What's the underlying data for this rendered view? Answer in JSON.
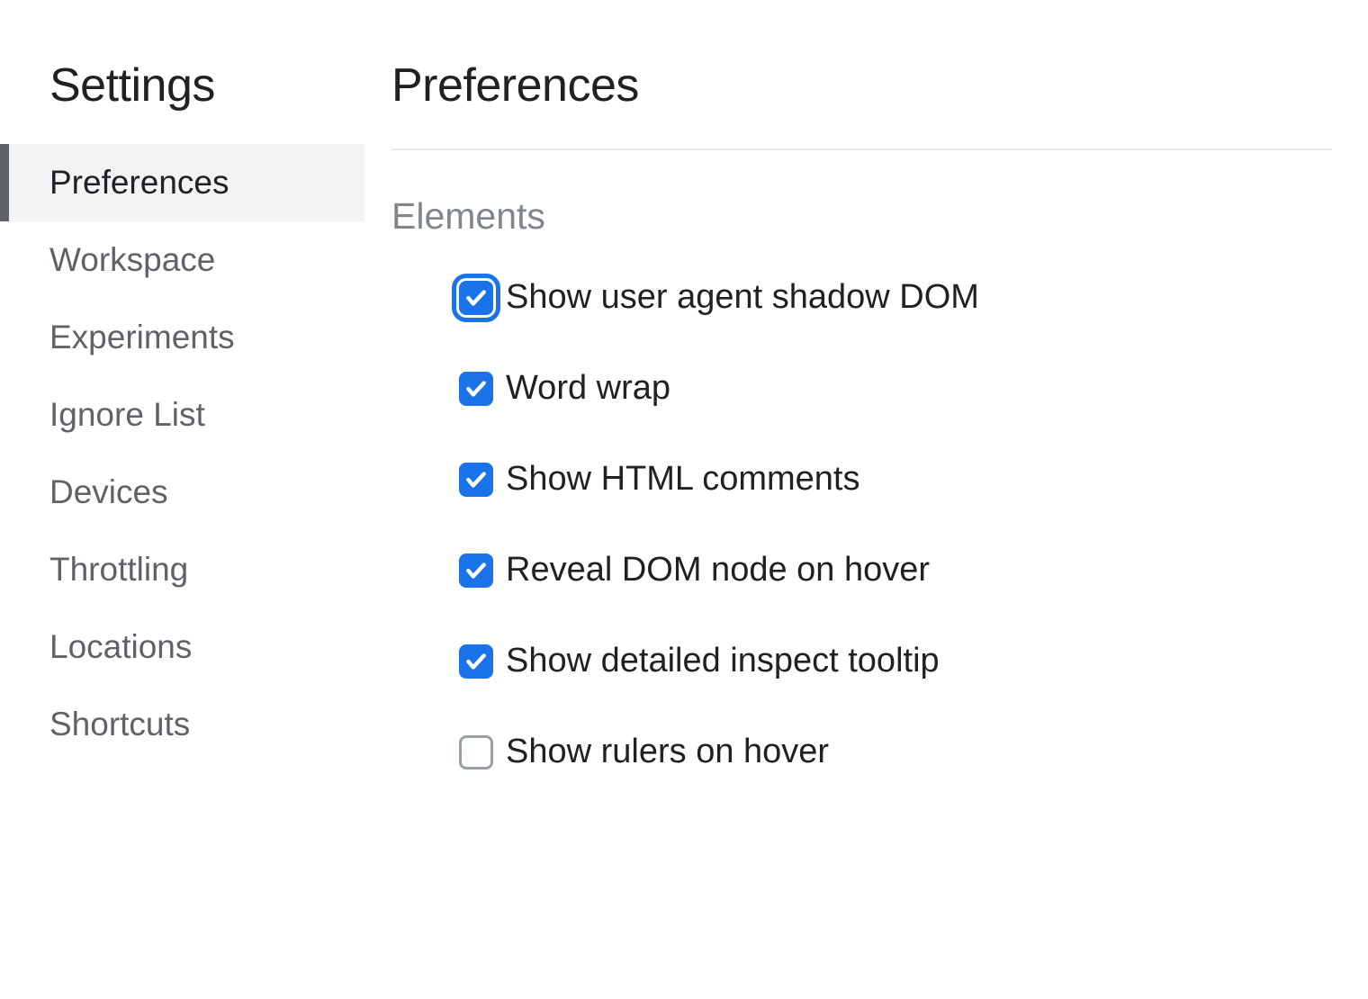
{
  "sidebar": {
    "title": "Settings",
    "items": [
      {
        "label": "Preferences",
        "active": true
      },
      {
        "label": "Workspace",
        "active": false
      },
      {
        "label": "Experiments",
        "active": false
      },
      {
        "label": "Ignore List",
        "active": false
      },
      {
        "label": "Devices",
        "active": false
      },
      {
        "label": "Throttling",
        "active": false
      },
      {
        "label": "Locations",
        "active": false
      },
      {
        "label": "Shortcuts",
        "active": false
      }
    ]
  },
  "main": {
    "title": "Preferences",
    "section": {
      "title": "Elements",
      "options": [
        {
          "label": "Show user agent shadow DOM",
          "checked": true,
          "focused": true
        },
        {
          "label": "Word wrap",
          "checked": true,
          "focused": false
        },
        {
          "label": "Show HTML comments",
          "checked": true,
          "focused": false
        },
        {
          "label": "Reveal DOM node on hover",
          "checked": true,
          "focused": false
        },
        {
          "label": "Show detailed inspect tooltip",
          "checked": true,
          "focused": false
        },
        {
          "label": "Show rulers on hover",
          "checked": false,
          "focused": false
        }
      ]
    }
  }
}
